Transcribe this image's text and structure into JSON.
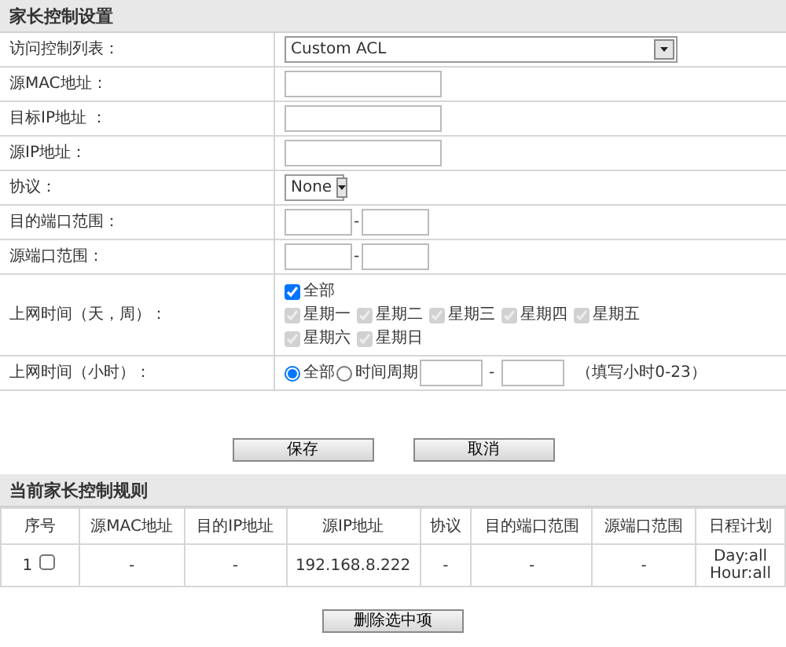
{
  "settings": {
    "title": "家长控制设置",
    "rows": [
      {
        "kind": "select",
        "label": "访问控制列表：",
        "value": "Custom ACL",
        "wide": true
      },
      {
        "kind": "text",
        "label": "源MAC地址："
      },
      {
        "kind": "text",
        "label": "目标IP地址 ："
      },
      {
        "kind": "text",
        "label": "源IP地址："
      },
      {
        "kind": "select",
        "label": "协议：",
        "value": "None",
        "wide": false
      },
      {
        "kind": "range",
        "label": "目的端口范围：",
        "separator": "-"
      },
      {
        "kind": "range",
        "label": "源端口范围：",
        "separator": "-"
      },
      {
        "kind": "days",
        "label": "上网时间（天，周）：",
        "all": {
          "label": "全部",
          "checked": true,
          "disabled": false
        },
        "days": [
          {
            "label": "星期一",
            "checked": true,
            "disabled": true
          },
          {
            "label": "星期二",
            "checked": true,
            "disabled": true
          },
          {
            "label": "星期三",
            "checked": true,
            "disabled": true
          },
          {
            "label": "星期四",
            "checked": true,
            "disabled": true
          },
          {
            "label": "星期五",
            "checked": true,
            "disabled": true
          },
          {
            "label": "星期六",
            "checked": true,
            "disabled": true
          },
          {
            "label": "星期日",
            "checked": true,
            "disabled": true
          }
        ]
      },
      {
        "kind": "hours",
        "label": "上网时间（小时）：",
        "options": [
          {
            "label": "全部",
            "selected": true
          },
          {
            "label": "时间周期",
            "selected": false
          }
        ],
        "separator": "-",
        "hint": "（填写小时0-23）"
      }
    ],
    "buttons": [
      "保存",
      "取消"
    ]
  },
  "rules": {
    "title": "当前家长控制规则",
    "columns": [
      "序号",
      "源MAC地址",
      "目的IP地址",
      "源IP地址",
      "协议",
      "目的端口范围",
      "源端口范围",
      "日程计划"
    ],
    "rows": [
      {
        "checked": false,
        "cells": [
          "1",
          "-",
          "-",
          "192.168.8.222",
          "-",
          "-",
          "-"
        ],
        "schedule": [
          "Day:all",
          "Hour:all"
        ]
      }
    ],
    "delete_button": "删除选中项"
  }
}
